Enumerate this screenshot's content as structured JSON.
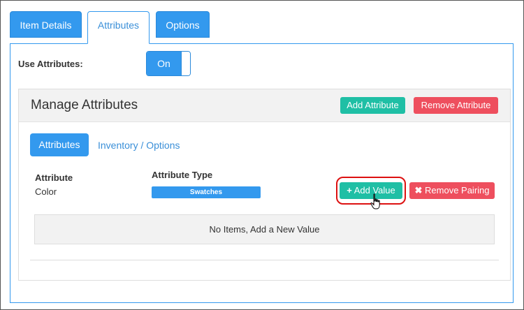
{
  "tabs": [
    {
      "label": "Item Details"
    },
    {
      "label": "Attributes"
    },
    {
      "label": "Options"
    }
  ],
  "use_attributes": {
    "label": "Use Attributes:",
    "toggle_label": "On"
  },
  "manage": {
    "title": "Manage Attributes",
    "add_attribute_label": "Add Attribute",
    "remove_attribute_label": "Remove Attribute"
  },
  "subtabs": {
    "attributes_label": "Attributes",
    "inventory_label": "Inventory / Options"
  },
  "attribute_table": {
    "attribute_header": "Attribute",
    "attribute_value": "Color",
    "type_header": "Attribute Type",
    "type_value": "Swatches",
    "add_value_label": "Add Value",
    "remove_pairing_label": "Remove Pairing"
  },
  "empty_message": "No Items, Add a New Value",
  "colors": {
    "primary": "#3399ee",
    "teal": "#1fbfa5",
    "danger": "#ee4f5e",
    "highlight": "#dd1111"
  }
}
